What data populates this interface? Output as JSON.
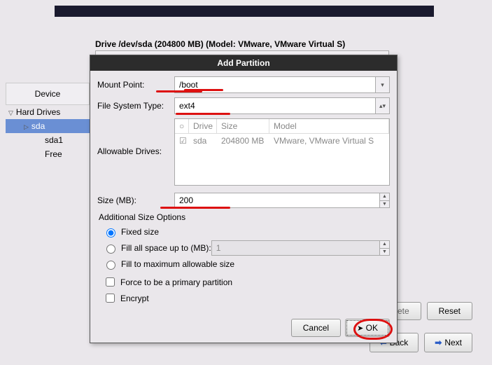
{
  "drive_info": "Drive /dev/sda (204800 MB) (Model: VMware, VMware Virtual S)",
  "tree": {
    "device_header": "Device",
    "hard_drives": "Hard Drives",
    "sda": "sda",
    "sda1": "sda1",
    "free": "Free"
  },
  "modal": {
    "title": "Add Partition",
    "mount_point_label": "Mount Point:",
    "mount_point_value": "/boot",
    "fs_type_label": "File System Type:",
    "fs_type_value": "ext4",
    "allowable_drives_label": "Allowable Drives:",
    "drives_table": {
      "head": {
        "drive": "Drive",
        "size": "Size",
        "model": "Model"
      },
      "row": {
        "checked": "☑",
        "drive": "sda",
        "size": "204800 MB",
        "model": "VMware, VMware Virtual S"
      }
    },
    "size_label": "Size (MB):",
    "size_value": "200",
    "additional_label": "Additional Size Options",
    "opt_fixed": "Fixed size",
    "opt_fill_up": "Fill all space up to (MB):",
    "opt_fill_up_value": "1",
    "opt_fill_max": "Fill to maximum allowable size",
    "force_primary": "Force to be a primary partition",
    "encrypt": "Encrypt",
    "cancel": "Cancel",
    "ok": "OK"
  },
  "bg": {
    "delete_partial": "lete",
    "reset": "Reset",
    "back": "Back",
    "next": "Next"
  }
}
